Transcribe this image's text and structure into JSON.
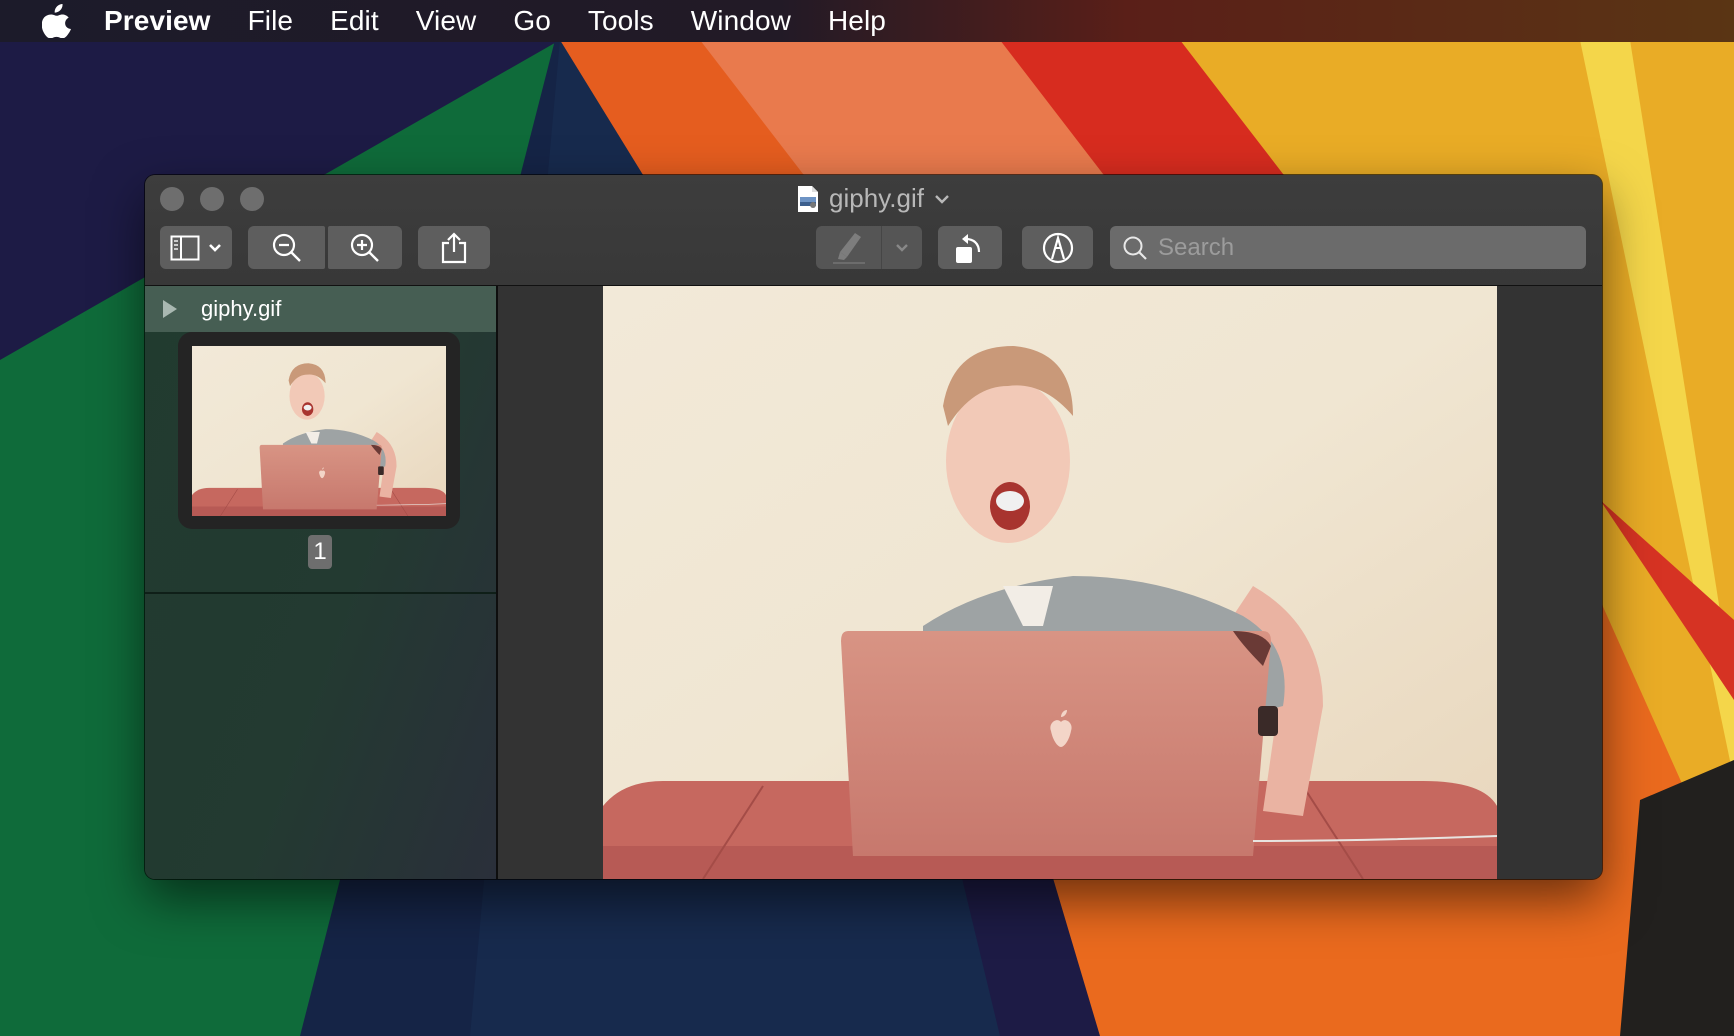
{
  "menubar": {
    "apple_icon": "apple-logo-icon",
    "items": [
      "Preview",
      "File",
      "Edit",
      "View",
      "Go",
      "Tools",
      "Window",
      "Help"
    ]
  },
  "window": {
    "title": "giphy.gif",
    "title_icon": "gif-document-icon",
    "title_chevron": "chevron-down-icon",
    "toolbar": {
      "sidebar_toggle": {
        "icon": "sidebar-icon",
        "menu_icon": "chevron-down-icon"
      },
      "zoom_out": {
        "icon": "zoom-out-icon"
      },
      "zoom_in": {
        "icon": "zoom-in-icon"
      },
      "share": {
        "icon": "share-icon"
      },
      "highlight": {
        "icon": "highlighter-icon",
        "menu_icon": "chevron-down-icon",
        "enabled": false
      },
      "rotate": {
        "icon": "rotate-left-icon"
      },
      "markup": {
        "icon": "markup-pen-icon"
      },
      "search": {
        "placeholder": "Search",
        "value": "",
        "icon": "search-icon"
      }
    },
    "sidebar": {
      "document_name": "giphy.gif",
      "disclosure_icon": "disclosure-triangle-icon",
      "pages": [
        {
          "number": "1",
          "selected": true
        }
      ]
    },
    "viewer": {
      "image_description": "Man laughing behind a laptop at a table"
    }
  },
  "colors": {
    "window_bg": "#323232",
    "toolbar_button": "#5e5e5e",
    "sidebar_header": "#465e53",
    "sidebar_bg": "#233a31"
  }
}
